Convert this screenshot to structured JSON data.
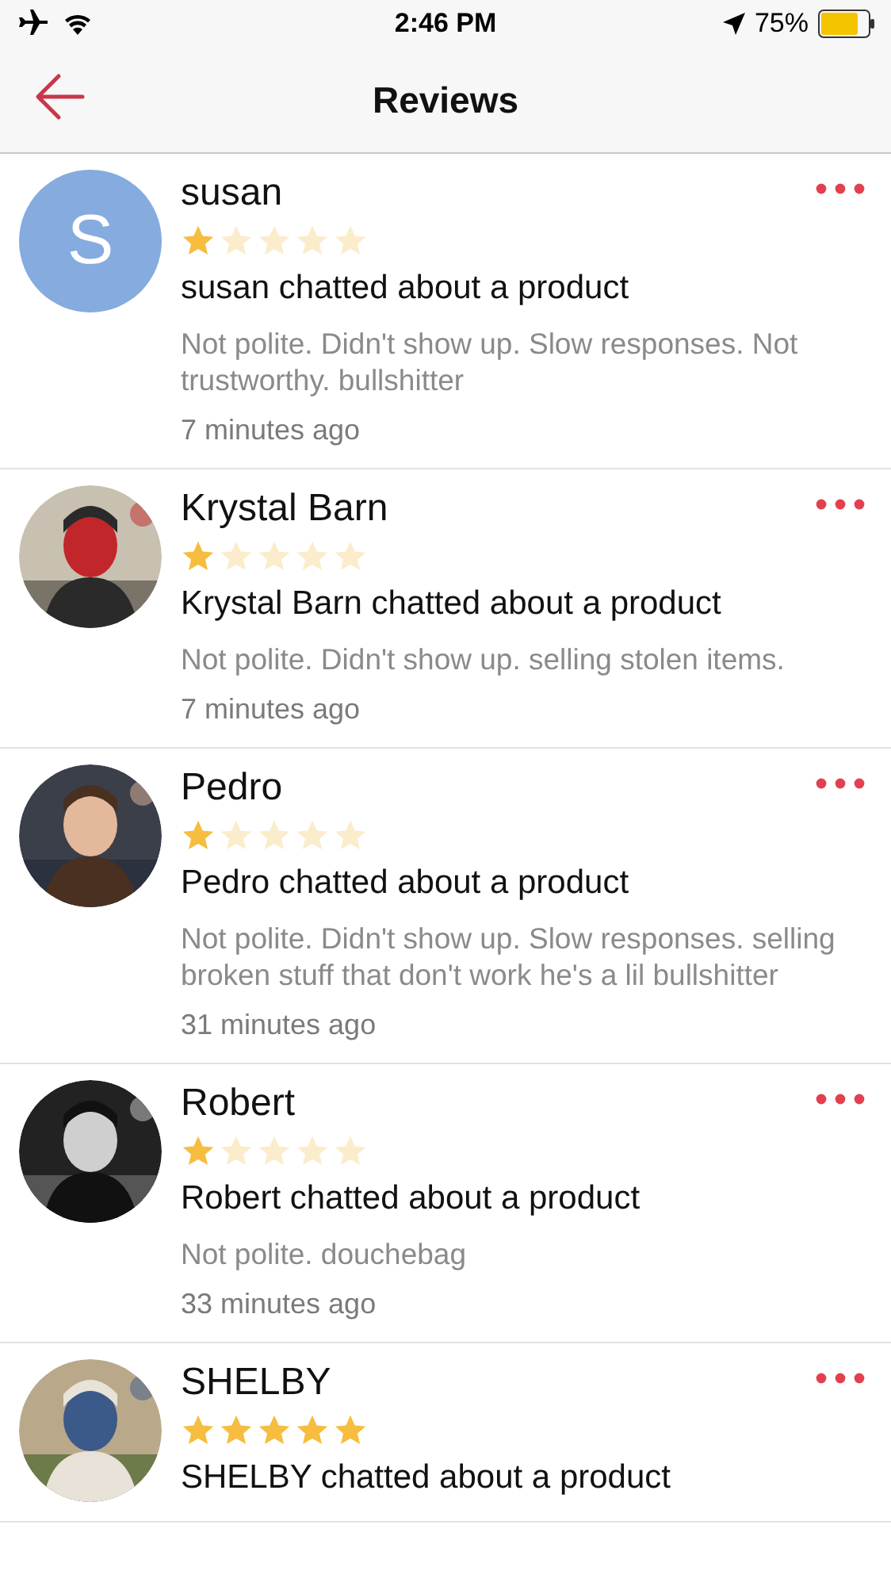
{
  "status_bar": {
    "time": "2:46 PM",
    "battery": "75%"
  },
  "nav": {
    "title": "Reviews"
  },
  "reviews": [
    {
      "avatar": {
        "kind": "letter",
        "letter": "S"
      },
      "name": "susan",
      "stars": 1,
      "headline": "susan chatted about a product",
      "comment": "Not polite. Didn't show up. Slow responses. Not trustworthy. bullshitter",
      "time": "7 minutes ago"
    },
    {
      "name": "Krystal Barn",
      "stars": 1,
      "headline": "Krystal Barn chatted about a product",
      "comment": "Not polite. Didn't show up. selling stolen items.",
      "time": "7 minutes ago"
    },
    {
      "name": "Pedro",
      "stars": 1,
      "headline": "Pedro chatted about a product",
      "comment": "Not polite. Didn't show up. Slow responses. selling broken stuff that don't work he's a lil bullshitter",
      "time": "31 minutes ago"
    },
    {
      "name": "Robert",
      "stars": 1,
      "headline": "Robert chatted about a product",
      "comment": "Not polite. douchebag",
      "time": "33 minutes ago"
    },
    {
      "name": "SHELBY",
      "stars": 5,
      "headline": "SHELBY chatted about a product"
    }
  ]
}
